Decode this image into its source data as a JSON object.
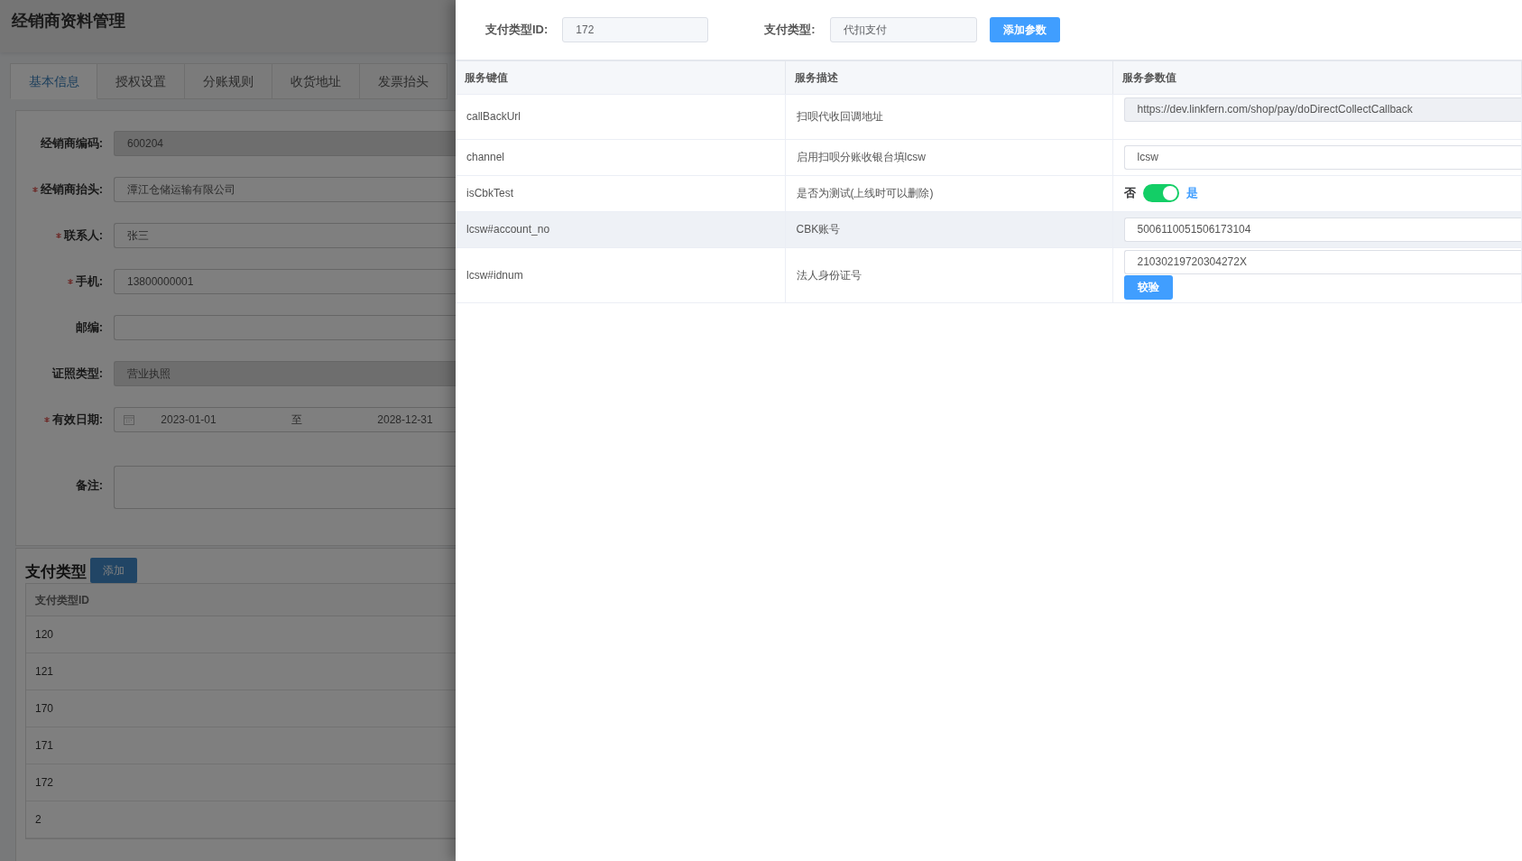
{
  "page": {
    "title": "经销商资料管理"
  },
  "tabs": [
    {
      "label": "基本信息",
      "selected": true
    },
    {
      "label": "授权设置",
      "selected": false
    },
    {
      "label": "分账规则",
      "selected": false
    },
    {
      "label": "收货地址",
      "selected": false
    },
    {
      "label": "发票抬头",
      "selected": false
    }
  ],
  "form": {
    "fields": [
      {
        "kind": "input",
        "label": "经销商编码:",
        "required": false,
        "value": "600204",
        "disabled": true
      },
      {
        "kind": "input",
        "label": "经销商抬头:",
        "required": true,
        "value": "潭江仓储运输有限公司",
        "disabled": false
      },
      {
        "kind": "input",
        "label": "联系人:",
        "required": true,
        "value": "张三",
        "disabled": false
      },
      {
        "kind": "input",
        "label": "手机:",
        "required": true,
        "value": "13800000001",
        "disabled": false
      },
      {
        "kind": "input",
        "label": "邮编:",
        "required": false,
        "disabled": false
      },
      {
        "kind": "input",
        "label": "证照类型:",
        "required": false,
        "value": "营业执照",
        "disabled": true
      },
      {
        "kind": "date_range",
        "label": "有效日期:",
        "required": true,
        "start": "2023-01-01",
        "separator": "至",
        "end": "2028-12-31"
      },
      {
        "kind": "textarea",
        "label": "备注:",
        "required": false
      }
    ]
  },
  "payment_types": {
    "title": "支付类型",
    "add_button": "添加",
    "columns": [
      "支付类型ID"
    ],
    "rows": [
      "120",
      "121",
      "170",
      "171",
      "172",
      "2"
    ]
  },
  "drawer": {
    "id_label": "支付类型ID:",
    "id_value": "172",
    "type_label": "支付类型:",
    "type_value": "代扣支付",
    "add_button": "添加参数",
    "columns": [
      "服务键值",
      "服务描述",
      "服务参数值"
    ],
    "rows": [
      {
        "key": "callBackUrl",
        "description": "扫呗代收回调地址",
        "hovered": false,
        "value": {
          "kind": "input",
          "text": "https://dev.linkfern.com/shop/pay/doDirectCollectCallback",
          "disabled": true
        }
      },
      {
        "key": "channel",
        "description": "启用扫呗分账收银台填lcsw",
        "hovered": false,
        "value": {
          "kind": "input",
          "text": "lcsw",
          "disabled": false
        }
      },
      {
        "key": "isCbkTest",
        "description": "是否为测试(上线时可以删除)",
        "hovered": false,
        "value": {
          "kind": "switch",
          "off_label": "否",
          "on_label": "是",
          "on": true
        }
      },
      {
        "key": "lcsw#account_no",
        "description": "CBK账号",
        "hovered": true,
        "value": {
          "kind": "input",
          "text": "5006110051506173104",
          "disabled": false
        }
      },
      {
        "key": "lcsw#idnum",
        "description": "法人身份证号",
        "hovered": false,
        "value": {
          "kind": "input_button",
          "text": "21030219720304272X",
          "button": "较验"
        }
      }
    ]
  }
}
